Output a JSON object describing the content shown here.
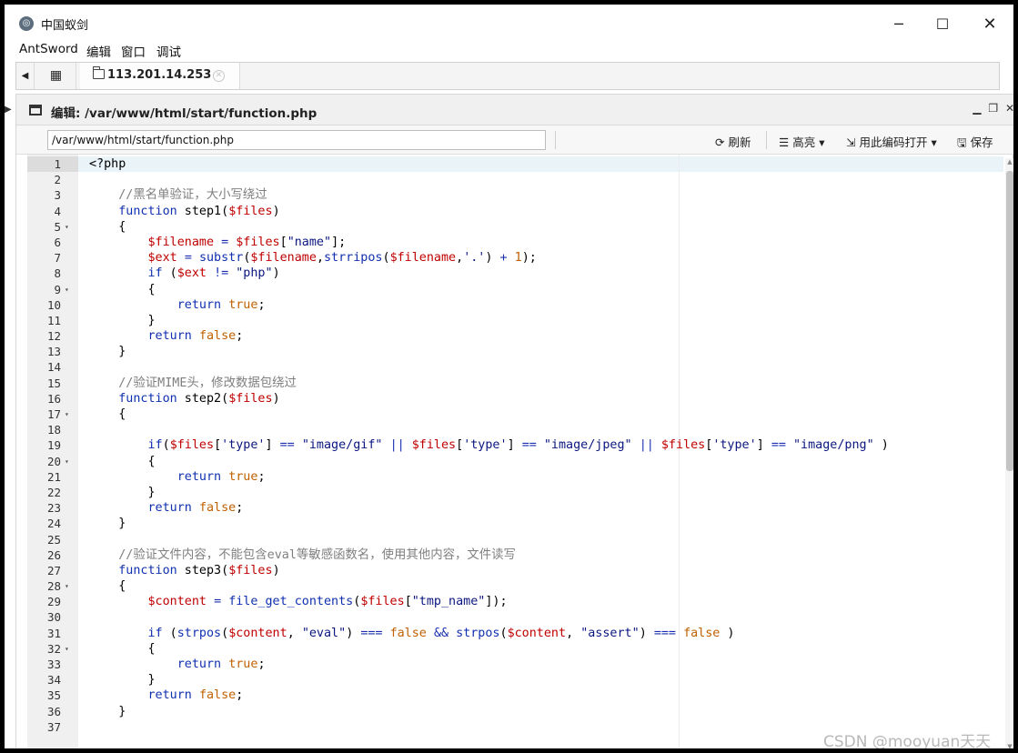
{
  "window": {
    "title": "中国蚁剑",
    "icon": "antsword-logo-icon",
    "minimize": "─",
    "maximize": "☐",
    "close": "✕"
  },
  "menu": {
    "items": [
      "AntSword",
      "编辑",
      "窗口",
      "调试"
    ]
  },
  "tabs": {
    "grid_icon": "grid-icon",
    "host_label": "113.201.14.253"
  },
  "editor_panel": {
    "title": "编辑: /var/www/html/start/function.php",
    "path_value": "/var/www/html/start/function.php",
    "refresh_label": "刷新",
    "highlight_label": "高亮",
    "open_with_encoding_label": "用此编码打开",
    "save_label": "保存"
  },
  "code": {
    "lines": [
      [
        {
          "t": "<?php",
          "c": ""
        }
      ],
      [],
      [
        {
          "t": "    //黑名单验证，大小写绕过",
          "c": "comment"
        }
      ],
      [
        {
          "t": "    ",
          "c": ""
        },
        {
          "t": "function",
          "c": "kw"
        },
        {
          "t": " step1(",
          "c": ""
        },
        {
          "t": "$files",
          "c": "var"
        },
        {
          "t": ")",
          "c": ""
        }
      ],
      [
        {
          "t": "    {",
          "c": ""
        }
      ],
      [
        {
          "t": "        ",
          "c": ""
        },
        {
          "t": "$filename",
          "c": "var"
        },
        {
          "t": " ",
          "c": ""
        },
        {
          "t": "=",
          "c": "op"
        },
        {
          "t": " ",
          "c": ""
        },
        {
          "t": "$files",
          "c": "var"
        },
        {
          "t": "[",
          "c": ""
        },
        {
          "t": "\"name\"",
          "c": "str"
        },
        {
          "t": "];",
          "c": ""
        }
      ],
      [
        {
          "t": "        ",
          "c": ""
        },
        {
          "t": "$ext",
          "c": "var"
        },
        {
          "t": " ",
          "c": ""
        },
        {
          "t": "=",
          "c": "op"
        },
        {
          "t": " ",
          "c": ""
        },
        {
          "t": "substr",
          "c": "fn"
        },
        {
          "t": "(",
          "c": ""
        },
        {
          "t": "$filename",
          "c": "var"
        },
        {
          "t": ",",
          "c": ""
        },
        {
          "t": "strripos",
          "c": "fn"
        },
        {
          "t": "(",
          "c": ""
        },
        {
          "t": "$filename",
          "c": "var"
        },
        {
          "t": ",",
          "c": ""
        },
        {
          "t": "'.'",
          "c": "str"
        },
        {
          "t": ") ",
          "c": ""
        },
        {
          "t": "+",
          "c": "op"
        },
        {
          "t": " ",
          "c": ""
        },
        {
          "t": "1",
          "c": "num"
        },
        {
          "t": ");",
          "c": ""
        }
      ],
      [
        {
          "t": "        ",
          "c": ""
        },
        {
          "t": "if",
          "c": "kw"
        },
        {
          "t": " (",
          "c": ""
        },
        {
          "t": "$ext",
          "c": "var"
        },
        {
          "t": " ",
          "c": ""
        },
        {
          "t": "!=",
          "c": "op"
        },
        {
          "t": " ",
          "c": ""
        },
        {
          "t": "\"php\"",
          "c": "str"
        },
        {
          "t": ")",
          "c": ""
        }
      ],
      [
        {
          "t": "        {",
          "c": ""
        }
      ],
      [
        {
          "t": "            ",
          "c": ""
        },
        {
          "t": "return",
          "c": "kw"
        },
        {
          "t": " ",
          "c": ""
        },
        {
          "t": "true",
          "c": "bool"
        },
        {
          "t": ";",
          "c": ""
        }
      ],
      [
        {
          "t": "        }",
          "c": ""
        }
      ],
      [
        {
          "t": "        ",
          "c": ""
        },
        {
          "t": "return",
          "c": "kw"
        },
        {
          "t": " ",
          "c": ""
        },
        {
          "t": "false",
          "c": "bool"
        },
        {
          "t": ";",
          "c": ""
        }
      ],
      [
        {
          "t": "    }",
          "c": ""
        }
      ],
      [],
      [
        {
          "t": "    //验证MIME头，修改数据包绕过",
          "c": "comment"
        }
      ],
      [
        {
          "t": "    ",
          "c": ""
        },
        {
          "t": "function",
          "c": "kw"
        },
        {
          "t": " step2(",
          "c": ""
        },
        {
          "t": "$files",
          "c": "var"
        },
        {
          "t": ")",
          "c": ""
        }
      ],
      [
        {
          "t": "    {",
          "c": ""
        }
      ],
      [],
      [
        {
          "t": "        ",
          "c": ""
        },
        {
          "t": "if",
          "c": "kw"
        },
        {
          "t": "(",
          "c": ""
        },
        {
          "t": "$files",
          "c": "var"
        },
        {
          "t": "[",
          "c": ""
        },
        {
          "t": "'type'",
          "c": "str"
        },
        {
          "t": "] ",
          "c": ""
        },
        {
          "t": "==",
          "c": "op"
        },
        {
          "t": " ",
          "c": ""
        },
        {
          "t": "\"image/gif\"",
          "c": "str"
        },
        {
          "t": " ",
          "c": ""
        },
        {
          "t": "||",
          "c": "op"
        },
        {
          "t": " ",
          "c": ""
        },
        {
          "t": "$files",
          "c": "var"
        },
        {
          "t": "[",
          "c": ""
        },
        {
          "t": "'type'",
          "c": "str"
        },
        {
          "t": "] ",
          "c": ""
        },
        {
          "t": "==",
          "c": "op"
        },
        {
          "t": " ",
          "c": ""
        },
        {
          "t": "\"image/jpeg\"",
          "c": "str"
        },
        {
          "t": " ",
          "c": ""
        },
        {
          "t": "||",
          "c": "op"
        },
        {
          "t": " ",
          "c": ""
        },
        {
          "t": "$files",
          "c": "var"
        },
        {
          "t": "[",
          "c": ""
        },
        {
          "t": "'type'",
          "c": "str"
        },
        {
          "t": "] ",
          "c": ""
        },
        {
          "t": "==",
          "c": "op"
        },
        {
          "t": " ",
          "c": ""
        },
        {
          "t": "\"image/png\"",
          "c": "str"
        },
        {
          "t": " )",
          "c": ""
        }
      ],
      [
        {
          "t": "        {",
          "c": ""
        }
      ],
      [
        {
          "t": "            ",
          "c": ""
        },
        {
          "t": "return",
          "c": "kw"
        },
        {
          "t": " ",
          "c": ""
        },
        {
          "t": "true",
          "c": "bool"
        },
        {
          "t": ";",
          "c": ""
        }
      ],
      [
        {
          "t": "        }",
          "c": ""
        }
      ],
      [
        {
          "t": "        ",
          "c": ""
        },
        {
          "t": "return",
          "c": "kw"
        },
        {
          "t": " ",
          "c": ""
        },
        {
          "t": "false",
          "c": "bool"
        },
        {
          "t": ";",
          "c": ""
        }
      ],
      [
        {
          "t": "    }",
          "c": ""
        }
      ],
      [],
      [
        {
          "t": "    //验证文件内容，不能包含eval等敏感函数名，使用其他内容，文件读写",
          "c": "comment"
        }
      ],
      [
        {
          "t": "    ",
          "c": ""
        },
        {
          "t": "function",
          "c": "kw"
        },
        {
          "t": " step3(",
          "c": ""
        },
        {
          "t": "$files",
          "c": "var"
        },
        {
          "t": ")",
          "c": ""
        }
      ],
      [
        {
          "t": "    {",
          "c": ""
        }
      ],
      [
        {
          "t": "        ",
          "c": ""
        },
        {
          "t": "$content",
          "c": "var"
        },
        {
          "t": " ",
          "c": ""
        },
        {
          "t": "=",
          "c": "op"
        },
        {
          "t": " ",
          "c": ""
        },
        {
          "t": "file_get_contents",
          "c": "fn"
        },
        {
          "t": "(",
          "c": ""
        },
        {
          "t": "$files",
          "c": "var"
        },
        {
          "t": "[",
          "c": ""
        },
        {
          "t": "\"tmp_name\"",
          "c": "str"
        },
        {
          "t": "]);",
          "c": ""
        }
      ],
      [],
      [
        {
          "t": "        ",
          "c": ""
        },
        {
          "t": "if",
          "c": "kw"
        },
        {
          "t": " (",
          "c": ""
        },
        {
          "t": "strpos",
          "c": "fn"
        },
        {
          "t": "(",
          "c": ""
        },
        {
          "t": "$content",
          "c": "var"
        },
        {
          "t": ", ",
          "c": ""
        },
        {
          "t": "\"eval\"",
          "c": "str"
        },
        {
          "t": ") ",
          "c": ""
        },
        {
          "t": "===",
          "c": "op"
        },
        {
          "t": " ",
          "c": ""
        },
        {
          "t": "false",
          "c": "bool"
        },
        {
          "t": " ",
          "c": ""
        },
        {
          "t": "&&",
          "c": "op"
        },
        {
          "t": " ",
          "c": ""
        },
        {
          "t": "strpos",
          "c": "fn"
        },
        {
          "t": "(",
          "c": ""
        },
        {
          "t": "$content",
          "c": "var"
        },
        {
          "t": ", ",
          "c": ""
        },
        {
          "t": "\"assert\"",
          "c": "str"
        },
        {
          "t": ") ",
          "c": ""
        },
        {
          "t": "===",
          "c": "op"
        },
        {
          "t": " ",
          "c": ""
        },
        {
          "t": "false",
          "c": "bool"
        },
        {
          "t": " )",
          "c": ""
        }
      ],
      [
        {
          "t": "        {",
          "c": ""
        }
      ],
      [
        {
          "t": "            ",
          "c": ""
        },
        {
          "t": "return",
          "c": "kw"
        },
        {
          "t": " ",
          "c": ""
        },
        {
          "t": "true",
          "c": "bool"
        },
        {
          "t": ";",
          "c": ""
        }
      ],
      [
        {
          "t": "        }",
          "c": ""
        }
      ],
      [
        {
          "t": "        ",
          "c": ""
        },
        {
          "t": "return",
          "c": "kw"
        },
        {
          "t": " ",
          "c": ""
        },
        {
          "t": "false",
          "c": "bool"
        },
        {
          "t": ";",
          "c": ""
        }
      ],
      [
        {
          "t": "    }",
          "c": ""
        }
      ],
      []
    ],
    "fold_lines": [
      5,
      9,
      17,
      20,
      28,
      32
    ]
  },
  "watermark": "CSDN @mooyuan天天"
}
